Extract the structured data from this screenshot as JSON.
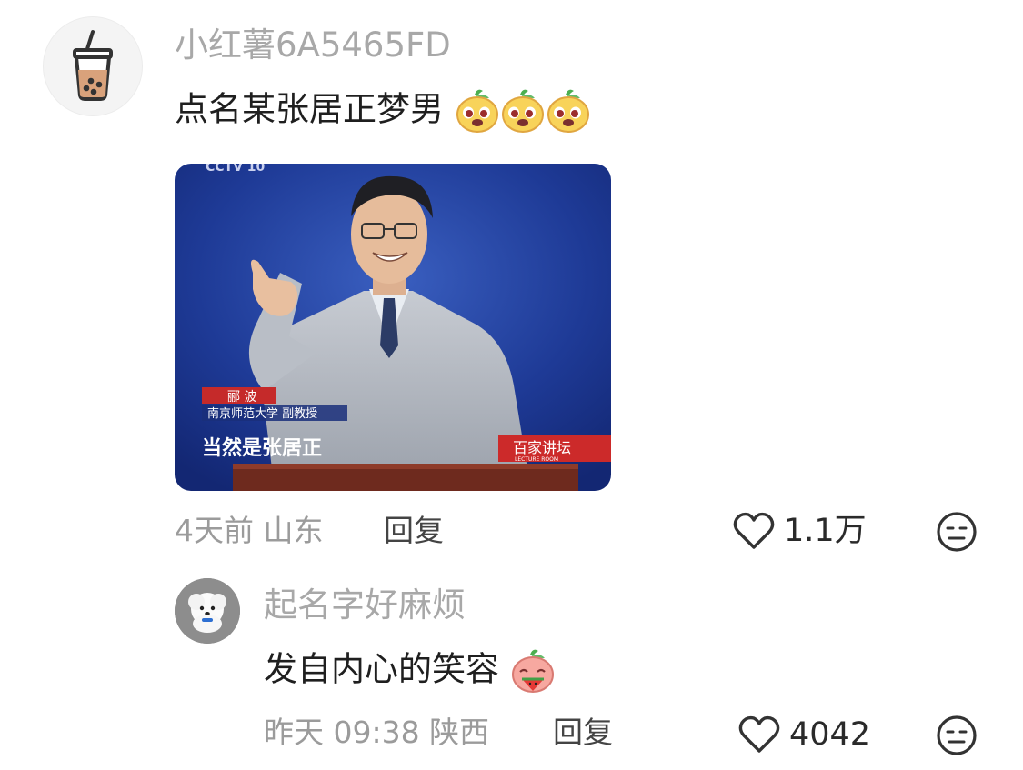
{
  "comment": {
    "username": "小红薯6A5465FD",
    "text": "点名某张居正梦男",
    "image": {
      "channel_logo": "CCTV 10",
      "name_caption": "郦 波",
      "title_caption": "南京师范大学 副教授",
      "subtitle": "当然是张居正",
      "program_logo": "百家讲坛",
      "program_logo_sub": "LECTURE ROOM"
    },
    "time": "4天前",
    "location": "山东",
    "reply_label": "回复",
    "likes": "1.1万",
    "avatar_icon": "bubble-tea-icon"
  },
  "reply": {
    "username": "起名字好麻烦",
    "text": "发自内心的笑容",
    "time": "昨天 09:38",
    "location": "陕西",
    "reply_label": "回复",
    "likes": "4042",
    "avatar_icon": "white-dog-avatar"
  }
}
